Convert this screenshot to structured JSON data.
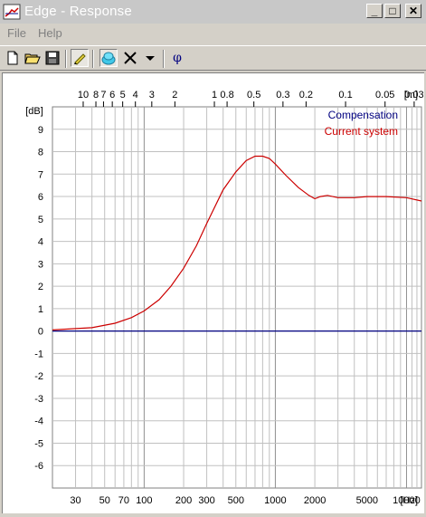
{
  "window": {
    "title": "Edge - Response",
    "controls": {
      "minimize": "_",
      "maximize": "□",
      "close": "✕"
    }
  },
  "menu": [
    {
      "label": "File"
    },
    {
      "label": "Help"
    }
  ],
  "toolbar": {
    "buttons": [
      {
        "name": "new-document-icon"
      },
      {
        "name": "open-folder-icon"
      },
      {
        "name": "save-disk-icon"
      },
      {
        "name": "pencil-edit-icon",
        "pressed": true
      },
      {
        "name": "speaker-icon",
        "pressed": true
      },
      {
        "name": "x-icon"
      },
      {
        "name": "dropdown-arrow-icon"
      },
      {
        "name": "phi-icon",
        "label": "φ"
      }
    ]
  },
  "chart_data": {
    "type": "line",
    "xscale": "log",
    "xlim": [
      20,
      13000
    ],
    "ylim": [
      -7,
      10
    ],
    "ylabel": "[dB]",
    "xunit": "[Hz]",
    "x_ticks": [
      "30",
      "50",
      "70",
      "100",
      "200",
      "300",
      "500",
      "1000",
      "2000",
      "5000",
      "10000"
    ],
    "y_ticks": [
      "9",
      "8",
      "7",
      "6",
      "5",
      "4",
      "3",
      "2",
      "1",
      "0",
      "-1",
      "-2",
      "-3",
      "-4",
      "-5",
      "-6"
    ],
    "top_axis": {
      "unit": "[m]",
      "ticks": [
        "10",
        "8",
        "7",
        "6",
        "5",
        "4",
        "3",
        "2",
        "1",
        "0.8",
        "0.5",
        "0.3",
        "0.2",
        "0.1",
        "0.05",
        "0.03"
      ]
    },
    "grid": true,
    "legend_position": "top-right",
    "series": [
      {
        "name": "Compensation",
        "color": "#000080",
        "x": [
          20,
          13000
        ],
        "y": [
          0,
          0
        ]
      },
      {
        "name": "Current system",
        "color": "#cc0000",
        "x": [
          20,
          40,
          60,
          80,
          100,
          130,
          160,
          200,
          250,
          300,
          400,
          500,
          600,
          700,
          800,
          900,
          1000,
          1200,
          1500,
          1800,
          2000,
          2200,
          2500,
          3000,
          4000,
          5000,
          7000,
          10000,
          13000
        ],
        "y": [
          0.05,
          0.15,
          0.35,
          0.6,
          0.9,
          1.4,
          2.0,
          2.8,
          3.8,
          4.8,
          6.3,
          7.1,
          7.6,
          7.8,
          7.8,
          7.7,
          7.45,
          6.95,
          6.4,
          6.05,
          5.9,
          6.0,
          6.05,
          5.95,
          5.95,
          6.0,
          6.0,
          5.95,
          5.8
        ]
      }
    ]
  }
}
